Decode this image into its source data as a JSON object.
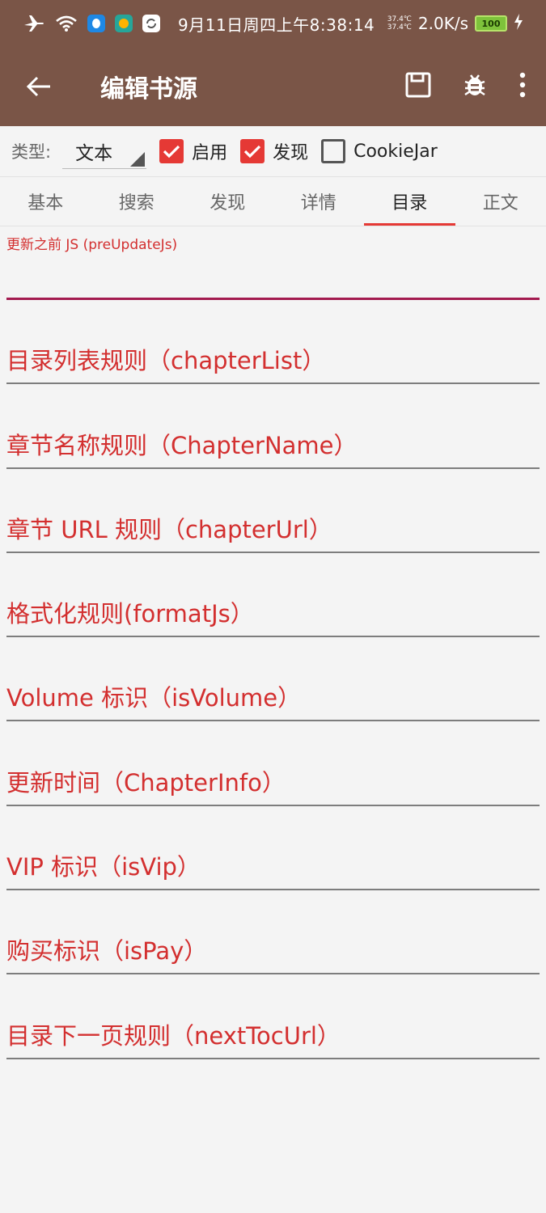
{
  "status": {
    "time": "9月11日周四上午8:38:14",
    "temp_top": "37.4℃",
    "temp_bottom": "37.4℃",
    "net_speed": "2.0K/s",
    "battery": "100",
    "icons": [
      "airplane-icon",
      "wifi-icon",
      "qq-icon",
      "app-icon",
      "sync-icon",
      "charging-icon"
    ]
  },
  "toolbar": {
    "title": "编辑书源",
    "icons": [
      "back-arrow-icon",
      "save-icon",
      "debug-bug-icon",
      "more-vert-icon"
    ]
  },
  "options": {
    "type_label": "类型:",
    "type_value": "文本",
    "enable_label": "启用",
    "enable_checked": true,
    "discover_label": "发现",
    "discover_checked": true,
    "cookiejar_label": "CookieJar",
    "cookiejar_checked": false
  },
  "tabs": [
    {
      "label": "基本"
    },
    {
      "label": "搜索"
    },
    {
      "label": "发现"
    },
    {
      "label": "详情"
    },
    {
      "label": "目录",
      "active": true
    },
    {
      "label": "正文"
    }
  ],
  "fields": {
    "pre_update_js_label": "更新之前 JS (preUpdateJs)",
    "hints": [
      "目录列表规则（chapterList）",
      "章节名称规则（ChapterName）",
      "章节 URL 规则（chapterUrl）",
      "格式化规则(formatJs）",
      "Volume 标识（isVolume）",
      "更新时间（ChapterInfo）",
      "VIP 标识（isVip）",
      "购买标识（isPay）",
      "目录下一页规则（nextTocUrl）"
    ]
  },
  "colors": {
    "toolbar": "#7a5547",
    "accent": "#e53935",
    "hint": "#d32f2f"
  }
}
